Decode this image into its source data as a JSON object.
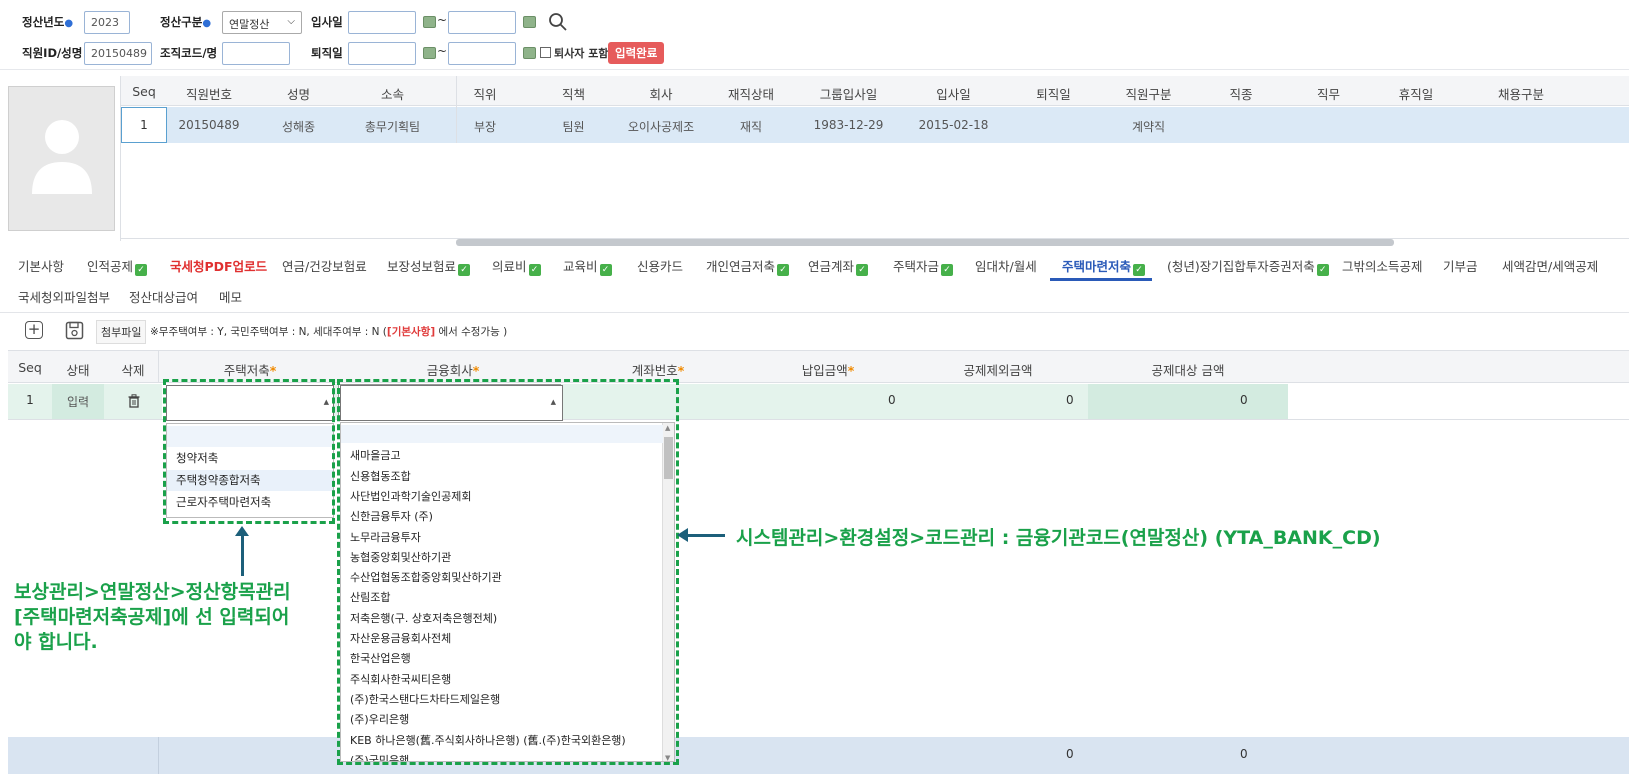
{
  "filters": {
    "year_label": "정산년도",
    "year_value": "2023",
    "type_label": "정산구분",
    "type_value": "연말정산",
    "hire_label": "입사일",
    "tilde": "~",
    "empid_label": "직원ID/성명",
    "empid_value": "20150489",
    "org_label": "조직코드/명",
    "retire_label": "퇴직일",
    "include_retired_label": "퇴사자 포함",
    "status_badge": "입력완료"
  },
  "employee_grid": {
    "headers": [
      "Seq",
      "직원번호",
      "성명",
      "소속",
      "직위",
      "직책",
      "회사",
      "재직상태",
      "그룹입사일",
      "입사일",
      "퇴직일",
      "직원구분",
      "직종",
      "직무",
      "휴직일",
      "채용구분"
    ],
    "row": [
      "1",
      "20150489",
      "성해종",
      "총무기획팀",
      "부장",
      "팀원",
      "오이사공제조",
      "재직",
      "1983-12-29",
      "2015-02-18",
      "",
      "계약직",
      "",
      "",
      "",
      ""
    ]
  },
  "tabs_row1": [
    {
      "label": "기본사항",
      "check": false,
      "style": "normal"
    },
    {
      "label": "인적공제",
      "check": true,
      "style": "normal"
    },
    {
      "label": "국세청PDF업로드",
      "check": false,
      "style": "red"
    },
    {
      "label": "연금/건강보험료",
      "check": false,
      "style": "normal"
    },
    {
      "label": "보장성보험료",
      "check": true,
      "style": "normal"
    },
    {
      "label": "의료비",
      "check": true,
      "style": "normal"
    },
    {
      "label": "교육비",
      "check": true,
      "style": "normal"
    },
    {
      "label": "신용카드",
      "check": false,
      "style": "normal"
    },
    {
      "label": "개인연금저축",
      "check": true,
      "style": "normal"
    },
    {
      "label": "연금계좌",
      "check": true,
      "style": "normal"
    },
    {
      "label": "주택자금",
      "check": true,
      "style": "normal"
    },
    {
      "label": "임대차/월세",
      "check": false,
      "style": "normal"
    },
    {
      "label": "주택마련저축",
      "check": true,
      "style": "active"
    },
    {
      "label": "(청년)장기집합투자증권저축",
      "check": true,
      "style": "normal"
    },
    {
      "label": "그밖의소득공제",
      "check": false,
      "style": "normal"
    },
    {
      "label": "기부금",
      "check": false,
      "style": "normal"
    },
    {
      "label": "세액감면/세액공제",
      "check": false,
      "style": "normal"
    }
  ],
  "tabs_row2": [
    "국세청외파일첨부",
    "정산대상급여",
    "메모"
  ],
  "toolbar": {
    "attach_label": "첨부파일",
    "notice_prefix": "※무주택여부 : Y, 국민주택여부 : N, 세대주여부 : N (",
    "notice_link": "[기본사항]",
    "notice_suffix": " 에서 수정가능 )"
  },
  "detail_grid": {
    "headers": [
      "Seq",
      "상태",
      "삭제",
      "주택저축",
      "금융회사",
      "계좌번호",
      "납입금액",
      "공제제외금액",
      "공제대상 금액"
    ],
    "required": [
      false,
      false,
      false,
      true,
      true,
      true,
      true,
      false,
      false
    ],
    "row": {
      "seq": "1",
      "status": "입력",
      "amount": "0",
      "excluded": "0",
      "target": "0"
    },
    "footer": {
      "excluded": "0",
      "target": "0"
    }
  },
  "savings_dropdown": {
    "options": [
      "",
      "청약저축",
      "주택청약종합저축",
      "근로자주택마련저축"
    ]
  },
  "bank_dropdown": {
    "options": [
      "",
      "새마을금고",
      "신용협동조합",
      "사단법인과학기술인공제회",
      "신한금융투자 (주)",
      "노무라금융투자",
      "농협중앙회및산하기관",
      "수산업협동조합중앙회및산하기관",
      "산림조합",
      "저축은행(구. 상호저축은행전체)",
      "자산운용금융회사전체",
      "한국산업은행",
      "주식회사한국씨티은행",
      "(주)한국스탠다드차타드제일은행",
      "(주)우리은행",
      "KEB 하나은행(舊.주식회사하나은행) (舊.(주)한국외환은행)",
      "(주)국민은행"
    ]
  },
  "annotations": {
    "bank_note": "시스템관리>환경설정>코드관리 : 금융기관코드(연말정산) (YTA_BANK_CD)",
    "savings_note_1": "보상관리>연말정산>정산항목관리",
    "savings_note_2": "[주택마련저축공제]에 선 입력되어",
    "savings_note_3": "야 합니다."
  },
  "colors": {
    "accent": "#2a5ab8",
    "annotation": "#1aa14a",
    "badge": "#e65b5b",
    "row_highlight": "#dbe9f6"
  }
}
